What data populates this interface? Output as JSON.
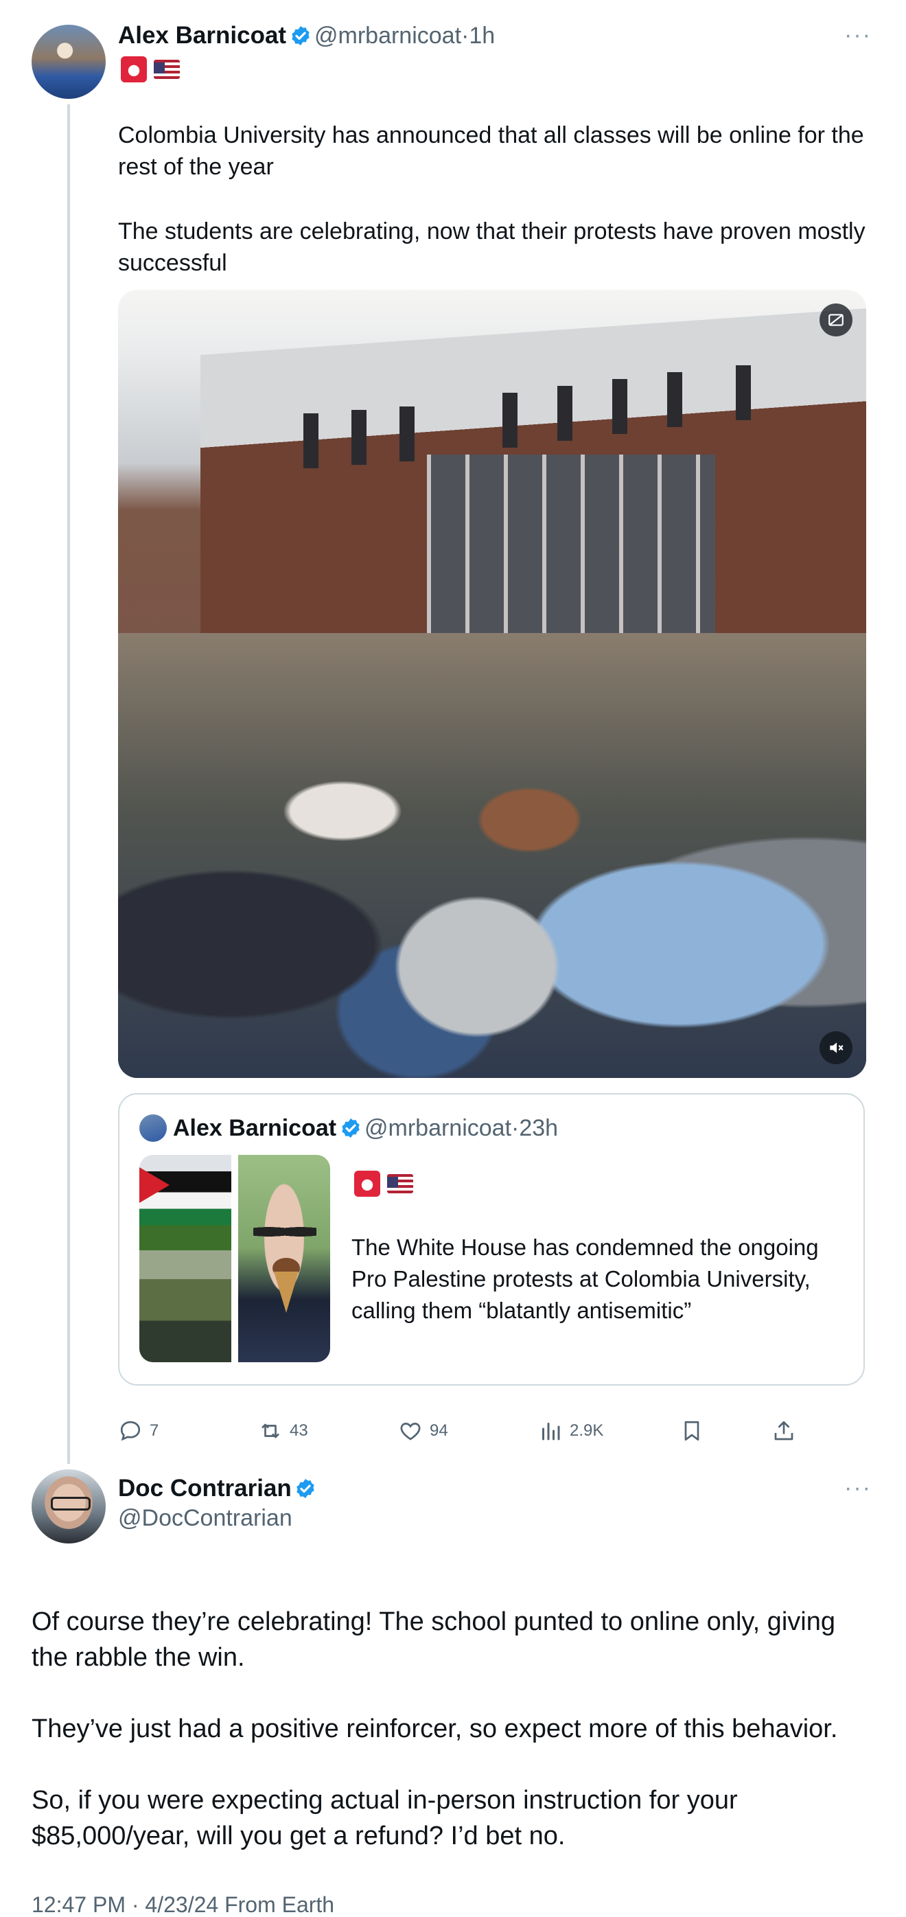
{
  "post": {
    "author_name": "Alex Barnicoat",
    "author_handle": "@mrbarnicoat",
    "separator": "·",
    "time": "1h",
    "more_label": "···",
    "emojis": [
      "siren-emoji",
      "us-flag-emoji"
    ],
    "paragraphs": [
      "Colombia University has announced that all classes will be online for the rest of the year",
      "The students are celebrating, now that their protests have proven mostly successful"
    ],
    "media": {
      "top_icon": "sensitive-content-icon",
      "mute_icon": "mute-icon"
    },
    "quote": {
      "author_name": "Alex Barnicoat",
      "author_handle": "@mrbarnicoat",
      "separator": "·",
      "time": "23h",
      "text": "The White House has condemned the ongoing Pro Palestine protests at Colombia University, calling them “blatantly antisemitic”"
    },
    "actions": {
      "replies": "7",
      "reposts": "43",
      "likes": "94",
      "views": "2.9K"
    }
  },
  "reply": {
    "author_name": "Doc Contrarian",
    "author_handle": "@DocContrarian",
    "more_label": "···",
    "paragraphs": [
      "Of course they’re celebrating! The school punted to online only, giving the rabble the win.",
      "They’ve just had a positive reinforcer, so expect more of this behavior.",
      "So, if you were expecting actual in-person instruction for your $85,000/year, will you get a refund? I’d bet no."
    ],
    "timestamp": "12:47 PM · 4/23/24 From Earth"
  },
  "colors": {
    "verified": "#1d9bf0",
    "secondary_text": "#536471",
    "border": "#cfd9de"
  }
}
